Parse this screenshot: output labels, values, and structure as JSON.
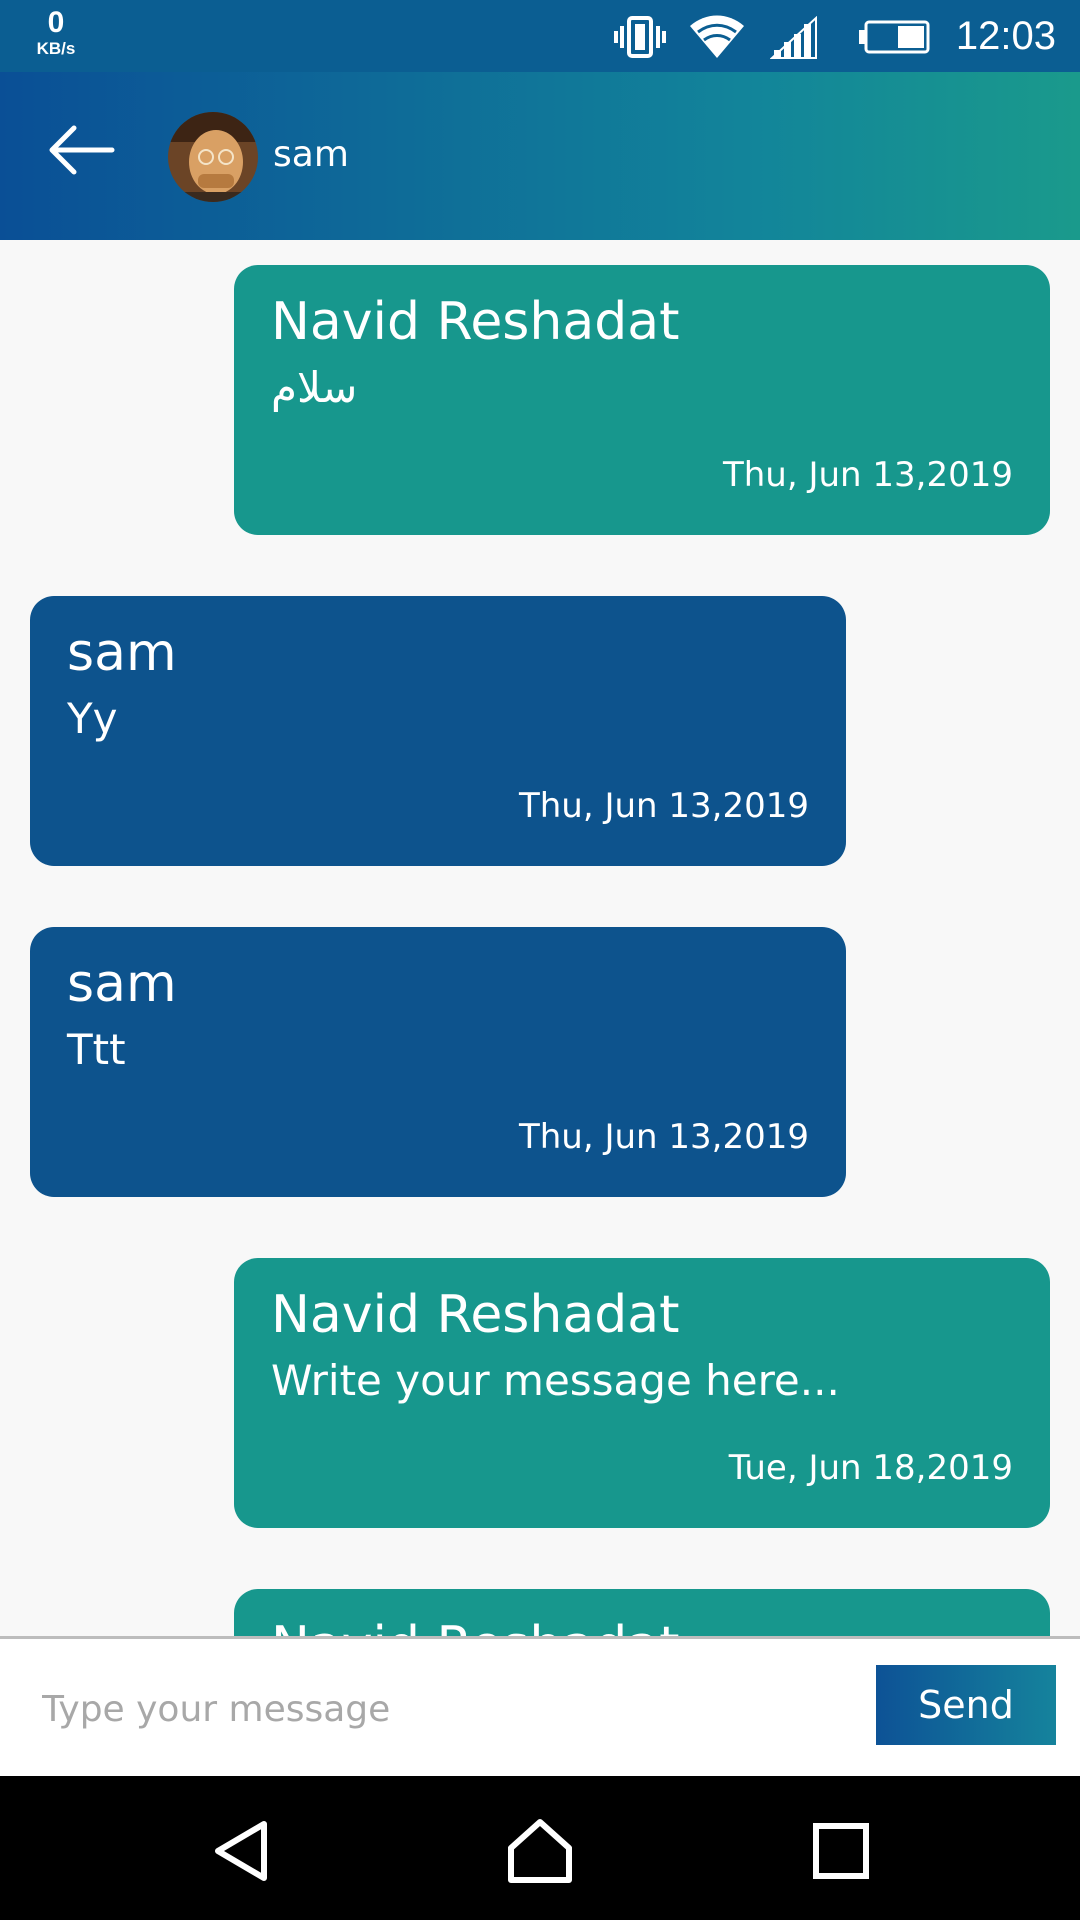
{
  "status_bar": {
    "net_speed_value": "0",
    "net_speed_unit": "KB/s",
    "time": "12:03",
    "icons": [
      "vibrate-icon",
      "wifi-icon",
      "signal-icon",
      "battery-icon"
    ]
  },
  "header": {
    "back_icon": "arrow-left-icon",
    "contact_name": "sam"
  },
  "messages": [
    {
      "direction": "out",
      "sender": "Navid Reshadat",
      "text": "سلام",
      "date": "Thu, Jun 13,2019"
    },
    {
      "direction": "in",
      "sender": "sam",
      "text": "Yy",
      "date": "Thu, Jun 13,2019"
    },
    {
      "direction": "in",
      "sender": "sam",
      "text": "Ttt",
      "date": "Thu, Jun 13,2019"
    },
    {
      "direction": "out",
      "sender": "Navid Reshadat",
      "text": "Write your message here...",
      "date": "Tue, Jun 18,2019"
    },
    {
      "direction": "out",
      "sender": "Navid Reshadat",
      "text": "",
      "date": ""
    }
  ],
  "composer": {
    "placeholder": "Type your message",
    "value": "",
    "send_label": "Send"
  },
  "nav_bar": {
    "icons": [
      "back-triangle-icon",
      "home-icon",
      "recents-square-icon"
    ]
  },
  "colors": {
    "status_bar": "#0b5e92",
    "outgoing_bubble": "#17978d",
    "incoming_bubble": "#0d538d",
    "background": "#f8f8f8"
  }
}
